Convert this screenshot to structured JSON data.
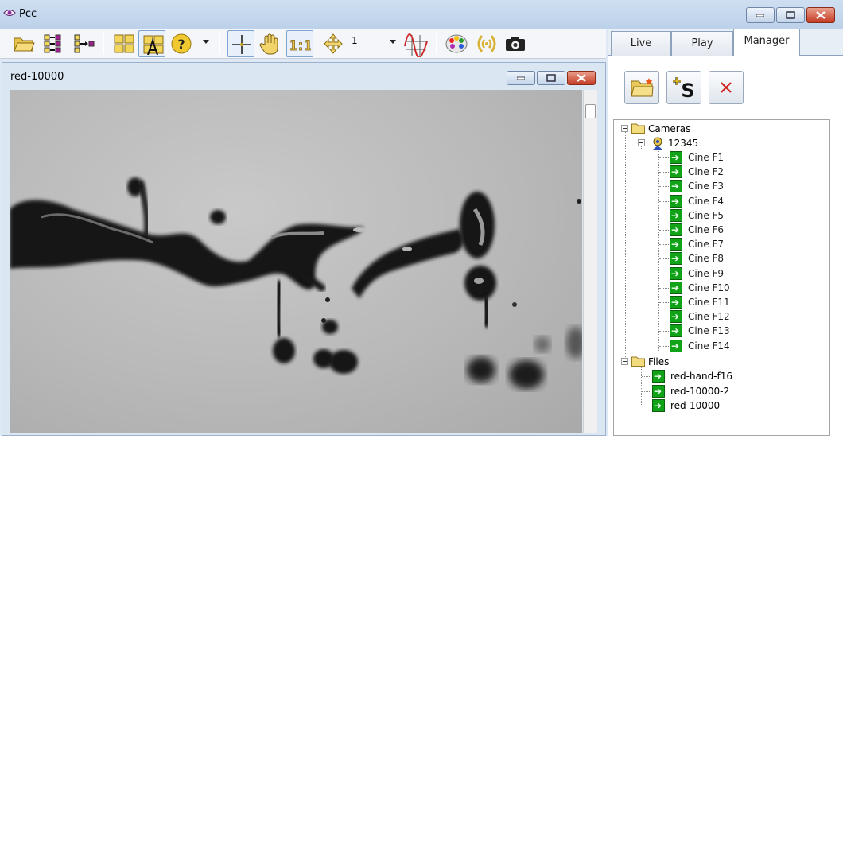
{
  "window": {
    "title": "Pcc"
  },
  "toolbar": {
    "zoom_value": "1"
  },
  "viewer": {
    "title": "red-10000"
  },
  "tabs": [
    {
      "label": "Live"
    },
    {
      "label": "Play"
    },
    {
      "label": "Manager"
    }
  ],
  "tree": {
    "cameras": {
      "label": "Cameras",
      "camera": {
        "label": "12345",
        "cines": [
          "Cine F1",
          "Cine F2",
          "Cine F3",
          "Cine F4",
          "Cine F5",
          "Cine F6",
          "Cine F7",
          "Cine F8",
          "Cine F9",
          "Cine F10",
          "Cine F11",
          "Cine F12",
          "Cine F13",
          "Cine F14"
        ]
      }
    },
    "files": {
      "label": "Files",
      "items": [
        "red-hand-f16",
        "red-10000-2",
        "red-10000"
      ]
    }
  },
  "colors": {
    "accent": "#dfe9f5",
    "close": "#c43b23",
    "cine_icon": "#11a317"
  }
}
